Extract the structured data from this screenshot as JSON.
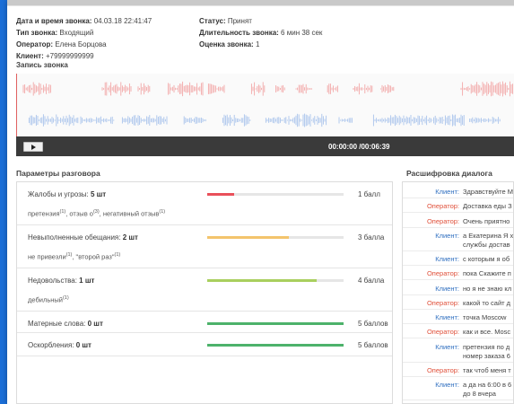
{
  "call_info": {
    "left": [
      {
        "label": "Дата и время звонка:",
        "value": "04.03.18 22:41:47"
      },
      {
        "label": "Тип звонка:",
        "value": "Входящий"
      },
      {
        "label": "Оператор:",
        "value": "Елена Борцова"
      },
      {
        "label": "Клиент:",
        "value": "+79999999999"
      }
    ],
    "right": [
      {
        "label": "Статус:",
        "value": "Принят"
      },
      {
        "label": "Длительность звонка:",
        "value": "6 мин 38 сек"
      },
      {
        "label": "Оценка звонка:",
        "value": "1"
      }
    ]
  },
  "recording": {
    "title": "Запись звонка",
    "time": "00:00:00 /00:06:39",
    "colors": {
      "operator_wave": "#f2a8a8",
      "client_wave": "#a9c4ec",
      "player_bg": "#3a3a3a"
    }
  },
  "params": {
    "title": "Параметры разговора",
    "rows": [
      {
        "label": "Жалобы и угрозы:",
        "count": "5 шт",
        "sub": [
          {
            "t": "претензия",
            "n": "(1)"
          },
          {
            "t": ", отзыв о",
            "n": "(3)"
          },
          {
            "t": ", негативный отзыв",
            "n": "(1)"
          }
        ],
        "score": "1 балл",
        "fill": 0.2,
        "color": "#e9505a"
      },
      {
        "label": "Невыполненные обещания:",
        "count": "2 шт",
        "sub": [
          {
            "t": "не привезли",
            "n": "(1)"
          },
          {
            "t": ", \"второй раз\"",
            "n": "(1)"
          }
        ],
        "score": "3 балла",
        "fill": 0.6,
        "color": "#f3c46c"
      },
      {
        "label": "Недовольства:",
        "count": "1 шт",
        "sub": [
          {
            "t": "дебильный",
            "n": "(1)"
          }
        ],
        "score": "4 балла",
        "fill": 0.8,
        "color": "#a9cf5e"
      },
      {
        "label": "Матерные слова:",
        "count": "0 шт",
        "sub": [],
        "score": "5 баллов",
        "fill": 1.0,
        "color": "#4db26b"
      },
      {
        "label": "Оскорбления:",
        "count": "0 шт",
        "sub": [],
        "score": "5 баллов",
        "fill": 1.0,
        "color": "#4db26b"
      }
    ]
  },
  "transcript": {
    "title": "Расшифровка диалога",
    "colors": {
      "client": "#2f6fc0",
      "operator": "#e0503a"
    },
    "lines": [
      {
        "speaker": "Клиент:",
        "role": "client",
        "text": "Здравствуйте М"
      },
      {
        "speaker": "Оператор:",
        "role": "operator",
        "text": "Доставка еды З"
      },
      {
        "speaker": "Оператор:",
        "role": "operator",
        "text": "Очень приятно"
      },
      {
        "speaker": "Клиент:",
        "role": "client",
        "text": "а Екатерина Я х",
        "text2": "службы достав"
      },
      {
        "speaker": "Клиент:",
        "role": "client",
        "text": "с которым я об"
      },
      {
        "speaker": "Оператор:",
        "role": "operator",
        "text": "пока Скажите п"
      },
      {
        "speaker": "Клиент:",
        "role": "client",
        "text": "но я не знаю кл"
      },
      {
        "speaker": "Оператор:",
        "role": "operator",
        "text": "какой то сайт д"
      },
      {
        "speaker": "Клиент:",
        "role": "client",
        "text": "точка Moscow"
      },
      {
        "speaker": "Оператор:",
        "role": "operator",
        "text": "как и все. Mosc"
      },
      {
        "speaker": "Клиент:",
        "role": "client",
        "text": "претензия по д",
        "text2": "номер заказа 6"
      },
      {
        "speaker": "Оператор:",
        "role": "operator",
        "text": "так чтоб меня т"
      },
      {
        "speaker": "Клиент:",
        "role": "client",
        "text": "а да на 6:00 в 6",
        "text2": "до 8 вчера"
      }
    ]
  }
}
